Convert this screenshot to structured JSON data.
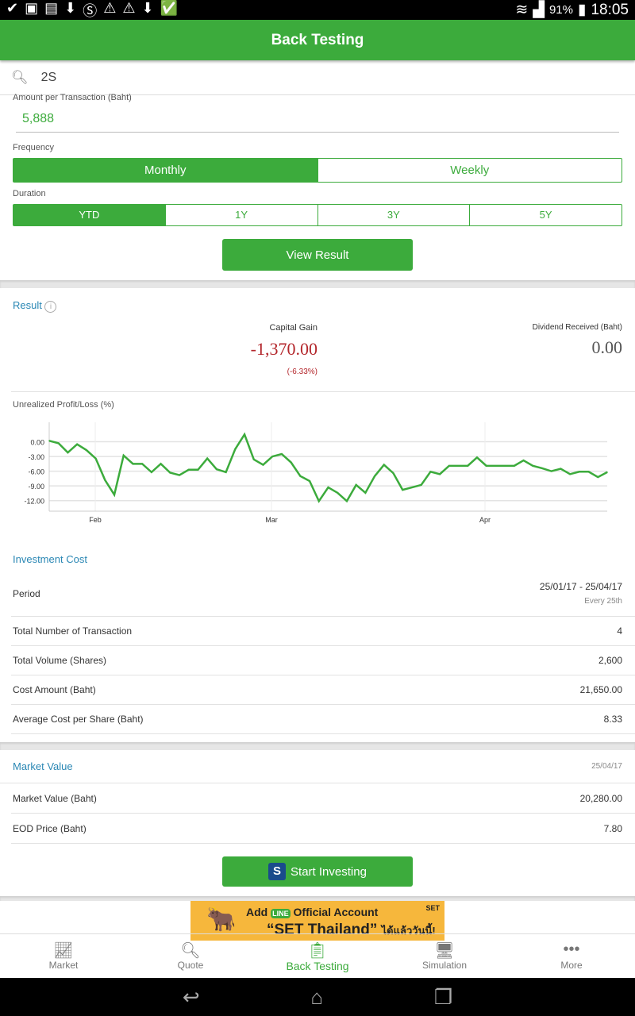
{
  "status": {
    "battery": "91%",
    "time": "18:05"
  },
  "header": {
    "title": "Back Testing"
  },
  "search": {
    "value": "2S"
  },
  "form": {
    "amount_label": "Amount per Transaction (Baht)",
    "amount_value": "5,888",
    "frequency_label": "Frequency",
    "frequency_options": [
      "Monthly",
      "Weekly"
    ],
    "frequency_selected": "Monthly",
    "duration_label": "Duration",
    "duration_options": [
      "YTD",
      "1Y",
      "3Y",
      "5Y"
    ],
    "duration_selected": "YTD",
    "view_button": "View Result"
  },
  "result": {
    "title": "Result",
    "capital_gain_label": "Capital Gain",
    "capital_gain": "-1,370.00",
    "capital_gain_pct": "(-6.33%)",
    "dividend_label": "Dividend Received (Baht)",
    "dividend": "0.00",
    "chart_label": "Unrealized Profit/Loss (%)"
  },
  "chart_data": {
    "type": "line",
    "ylabel": "",
    "xlabel": "",
    "yticks": [
      "0.00",
      "-3.00",
      "-6.00",
      "-9.00",
      "-12.00"
    ],
    "xticks": [
      "Feb",
      "Mar",
      "Apr"
    ],
    "ylim": [
      -13.5,
      3
    ],
    "grid": true,
    "color": "#3cab3c",
    "values": [
      0.2,
      -0.3,
      -2.2,
      -0.5,
      -1.7,
      -3.4,
      -7.8,
      -10.8,
      -2.8,
      -4.5,
      -4.5,
      -6.2,
      -4.5,
      -6.3,
      -6.8,
      -5.7,
      -5.7,
      -3.4,
      -5.6,
      -6.2,
      -1.5,
      1.5,
      -3.6,
      -4.7,
      -3.0,
      -2.5,
      -4.2,
      -7.0,
      -8.0,
      -12.1,
      -9.3,
      -10.4,
      -12.1,
      -8.8,
      -10.4,
      -7.0,
      -4.7,
      -6.4,
      -9.8,
      -9.3,
      -8.8,
      -6.1,
      -6.6,
      -4.9,
      -4.9,
      -4.9,
      -3.2,
      -4.9,
      -4.9,
      -4.9,
      -4.9,
      -3.8,
      -4.9,
      -5.4,
      -6.0,
      -5.5,
      -6.6,
      -6.1,
      -6.1,
      -7.2,
      -6.2
    ]
  },
  "investment": {
    "title": "Investment Cost",
    "period_label": "Period",
    "period": "25/01/17 - 25/04/17",
    "period_sub": "Every 25th",
    "rows": [
      {
        "label": "Total Number of Transaction",
        "value": "4"
      },
      {
        "label": "Total Volume (Shares)",
        "value": "2,600"
      },
      {
        "label": "Cost Amount (Baht)",
        "value": "21,650.00"
      },
      {
        "label": "Average Cost per Share (Baht)",
        "value": "8.33"
      }
    ]
  },
  "market": {
    "title": "Market Value",
    "date": "25/04/17",
    "rows": [
      {
        "label": "Market Value (Baht)",
        "value": "20,280.00"
      },
      {
        "label": "EOD Price (Baht)",
        "value": "7.80"
      }
    ],
    "start_button": "Start Investing"
  },
  "banner": {
    "line1": "Add",
    "line1b": "Official Account",
    "line2": "“SET Thailand”",
    "line2b": "ได้แล้ววันนี้!",
    "logo": "SET"
  },
  "nav": [
    {
      "label": "Market",
      "icon": "chart-icon"
    },
    {
      "label": "Quote",
      "icon": "search-icon"
    },
    {
      "label": "Back Testing",
      "icon": "clipboard-icon"
    },
    {
      "label": "Simulation",
      "icon": "monitor-icon"
    },
    {
      "label": "More",
      "icon": "more-icon"
    }
  ]
}
